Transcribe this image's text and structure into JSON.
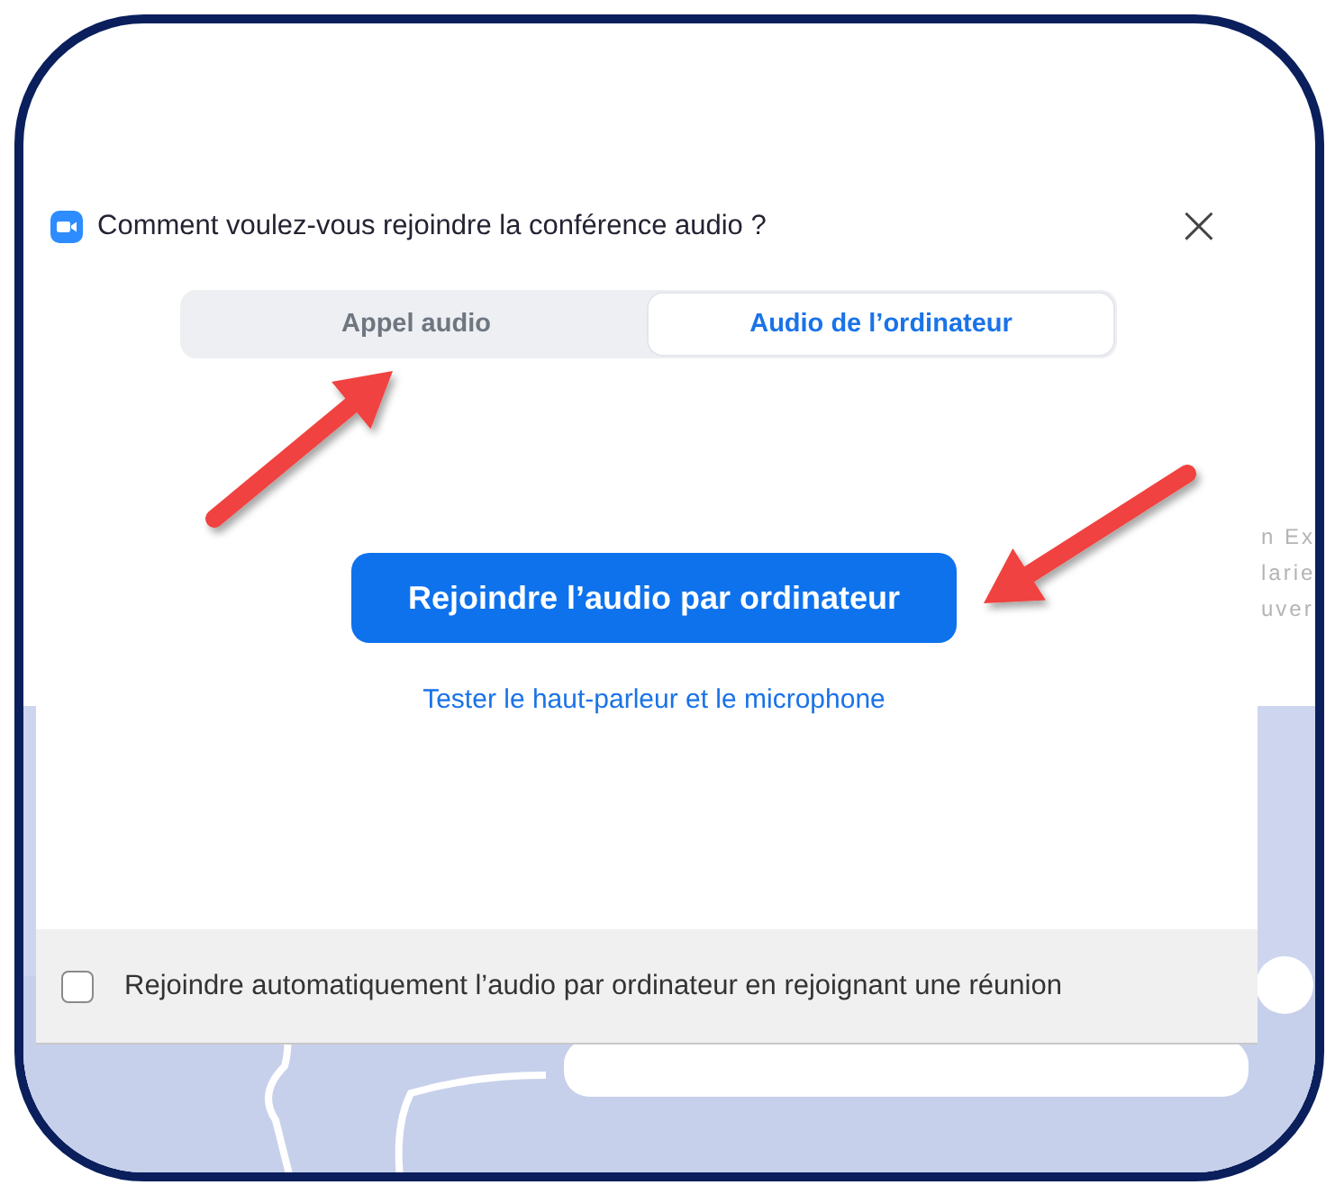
{
  "dialog": {
    "title": "Comment voulez-vous rejoindre la conférence audio ?",
    "close": "×",
    "tabs": [
      {
        "label": "Appel audio",
        "selected": false
      },
      {
        "label": "Audio de l’ordinateur",
        "selected": true
      }
    ],
    "join_button": "Rejoindre l’audio par ordinateur",
    "test_link": "Tester le haut-parleur et le microphone",
    "auto_join": {
      "label": "Rejoindre automatiquement l’audio par ordinateur en rejoignant une réunion",
      "checked": false
    }
  },
  "background_fragments": [
    "n Ex",
    "larie",
    "uver"
  ]
}
